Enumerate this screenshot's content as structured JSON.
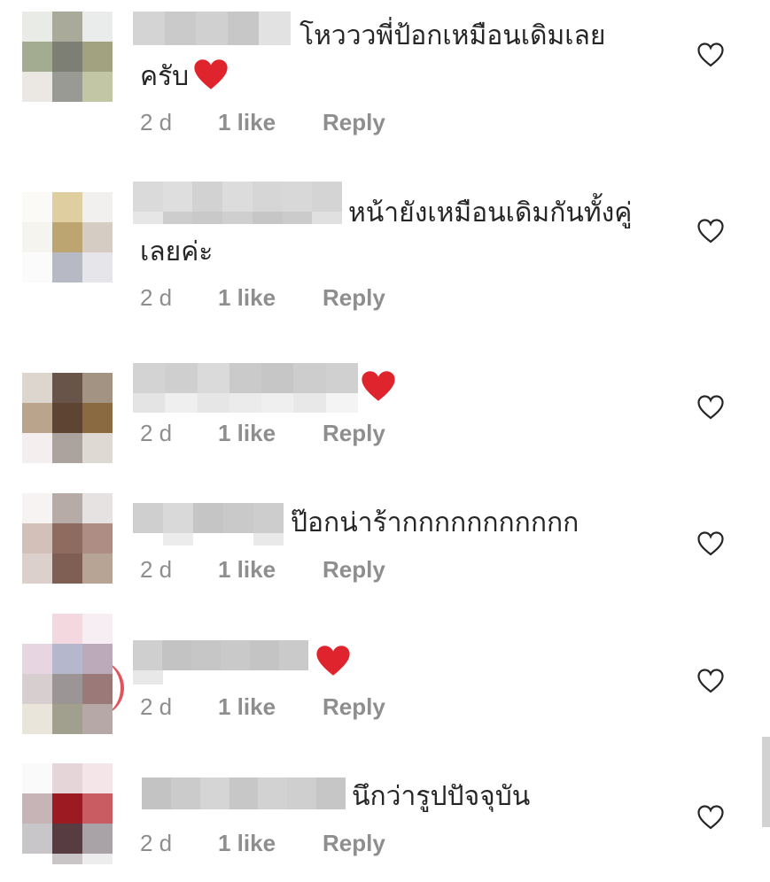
{
  "comments": [
    {
      "text_line1": "โหวววพี่ป้อกเหมือนเดิมเลย",
      "text_line2": "ครับ",
      "time": "2 d",
      "likes": "1 like",
      "reply": "Reply",
      "has_heart_emoji": true,
      "avatar_colors": [
        "#e9ebe6",
        "#a9aa99",
        "#e9ecea",
        "#a3ac90",
        "#7e7f74",
        "#a2a281",
        "#ebe8e4",
        "#9a9a94",
        "#c2c6a5"
      ]
    },
    {
      "text_line1": "หน้ายังเหมือนเดิมกันทั้งคู่",
      "text_line2": "เลยค่ะ",
      "time": "2 d",
      "likes": "1 like",
      "reply": "Reply",
      "has_heart_emoji": false,
      "avatar_colors": [
        "#fbfaf7",
        "#dfcfa0",
        "#f2f0ee",
        "#f6f4ef",
        "#bca571",
        "#d5cdc4",
        "#fbfbfb",
        "#b7bac4",
        "#e6e6ea"
      ]
    },
    {
      "text_line1": "",
      "text_line2": "",
      "time": "2 d",
      "likes": "1 like",
      "reply": "Reply",
      "has_heart_emoji": true,
      "avatar_colors": [
        "#dcd6ce",
        "#685449",
        "#a39383",
        "#bba48c",
        "#5e4433",
        "#8a6a40",
        "#f4efee",
        "#aca29e",
        "#dfd9d3"
      ]
    },
    {
      "text_line1": "ป๊อกน่าร้ากกกกกกกกกกก",
      "text_line2": "",
      "time": "2 d",
      "likes": "1 like",
      "reply": "Reply",
      "has_heart_emoji": false,
      "avatar_colors": [
        "#f6f3f2",
        "#b7aba8",
        "#e6e2e2",
        "#d3c0b8",
        "#8e6b5e",
        "#ae8d84",
        "#dcd0cc",
        "#7f5e53",
        "#b7a495"
      ]
    },
    {
      "text_line1": "",
      "text_line2": "",
      "time": "2 d",
      "likes": "1 like",
      "reply": "Reply",
      "has_heart_emoji": true,
      "avatar_colors": [
        "#e7d5e1",
        "#b5b8cd",
        "#bcaabb",
        "#d6cecf",
        "#9b9596",
        "#9a7978",
        "#e9e5da",
        "#a19f8d",
        "#b5a8a6"
      ]
    },
    {
      "text_line1": "นึกว่ารูปปัจจุบัน",
      "text_line2": "",
      "time": "2 d",
      "likes": "1 like",
      "reply": "Reply",
      "has_heart_emoji": false,
      "avatar_colors": [
        "#fafafa",
        "#e5d4d8",
        "#f4e6e8",
        "#c6b4b6",
        "#9c1b22",
        "#c95b63",
        "#c8c6c8",
        "#573c42",
        "#a9a3a8"
      ]
    }
  ],
  "icons": {
    "like": "heart-outline-icon",
    "heart_emoji": "red-heart-emoji"
  },
  "colors": {
    "text": "#262626",
    "meta": "#8e8e8e",
    "heart_emoji": "#e0242d",
    "heart_outline": "#262626"
  }
}
